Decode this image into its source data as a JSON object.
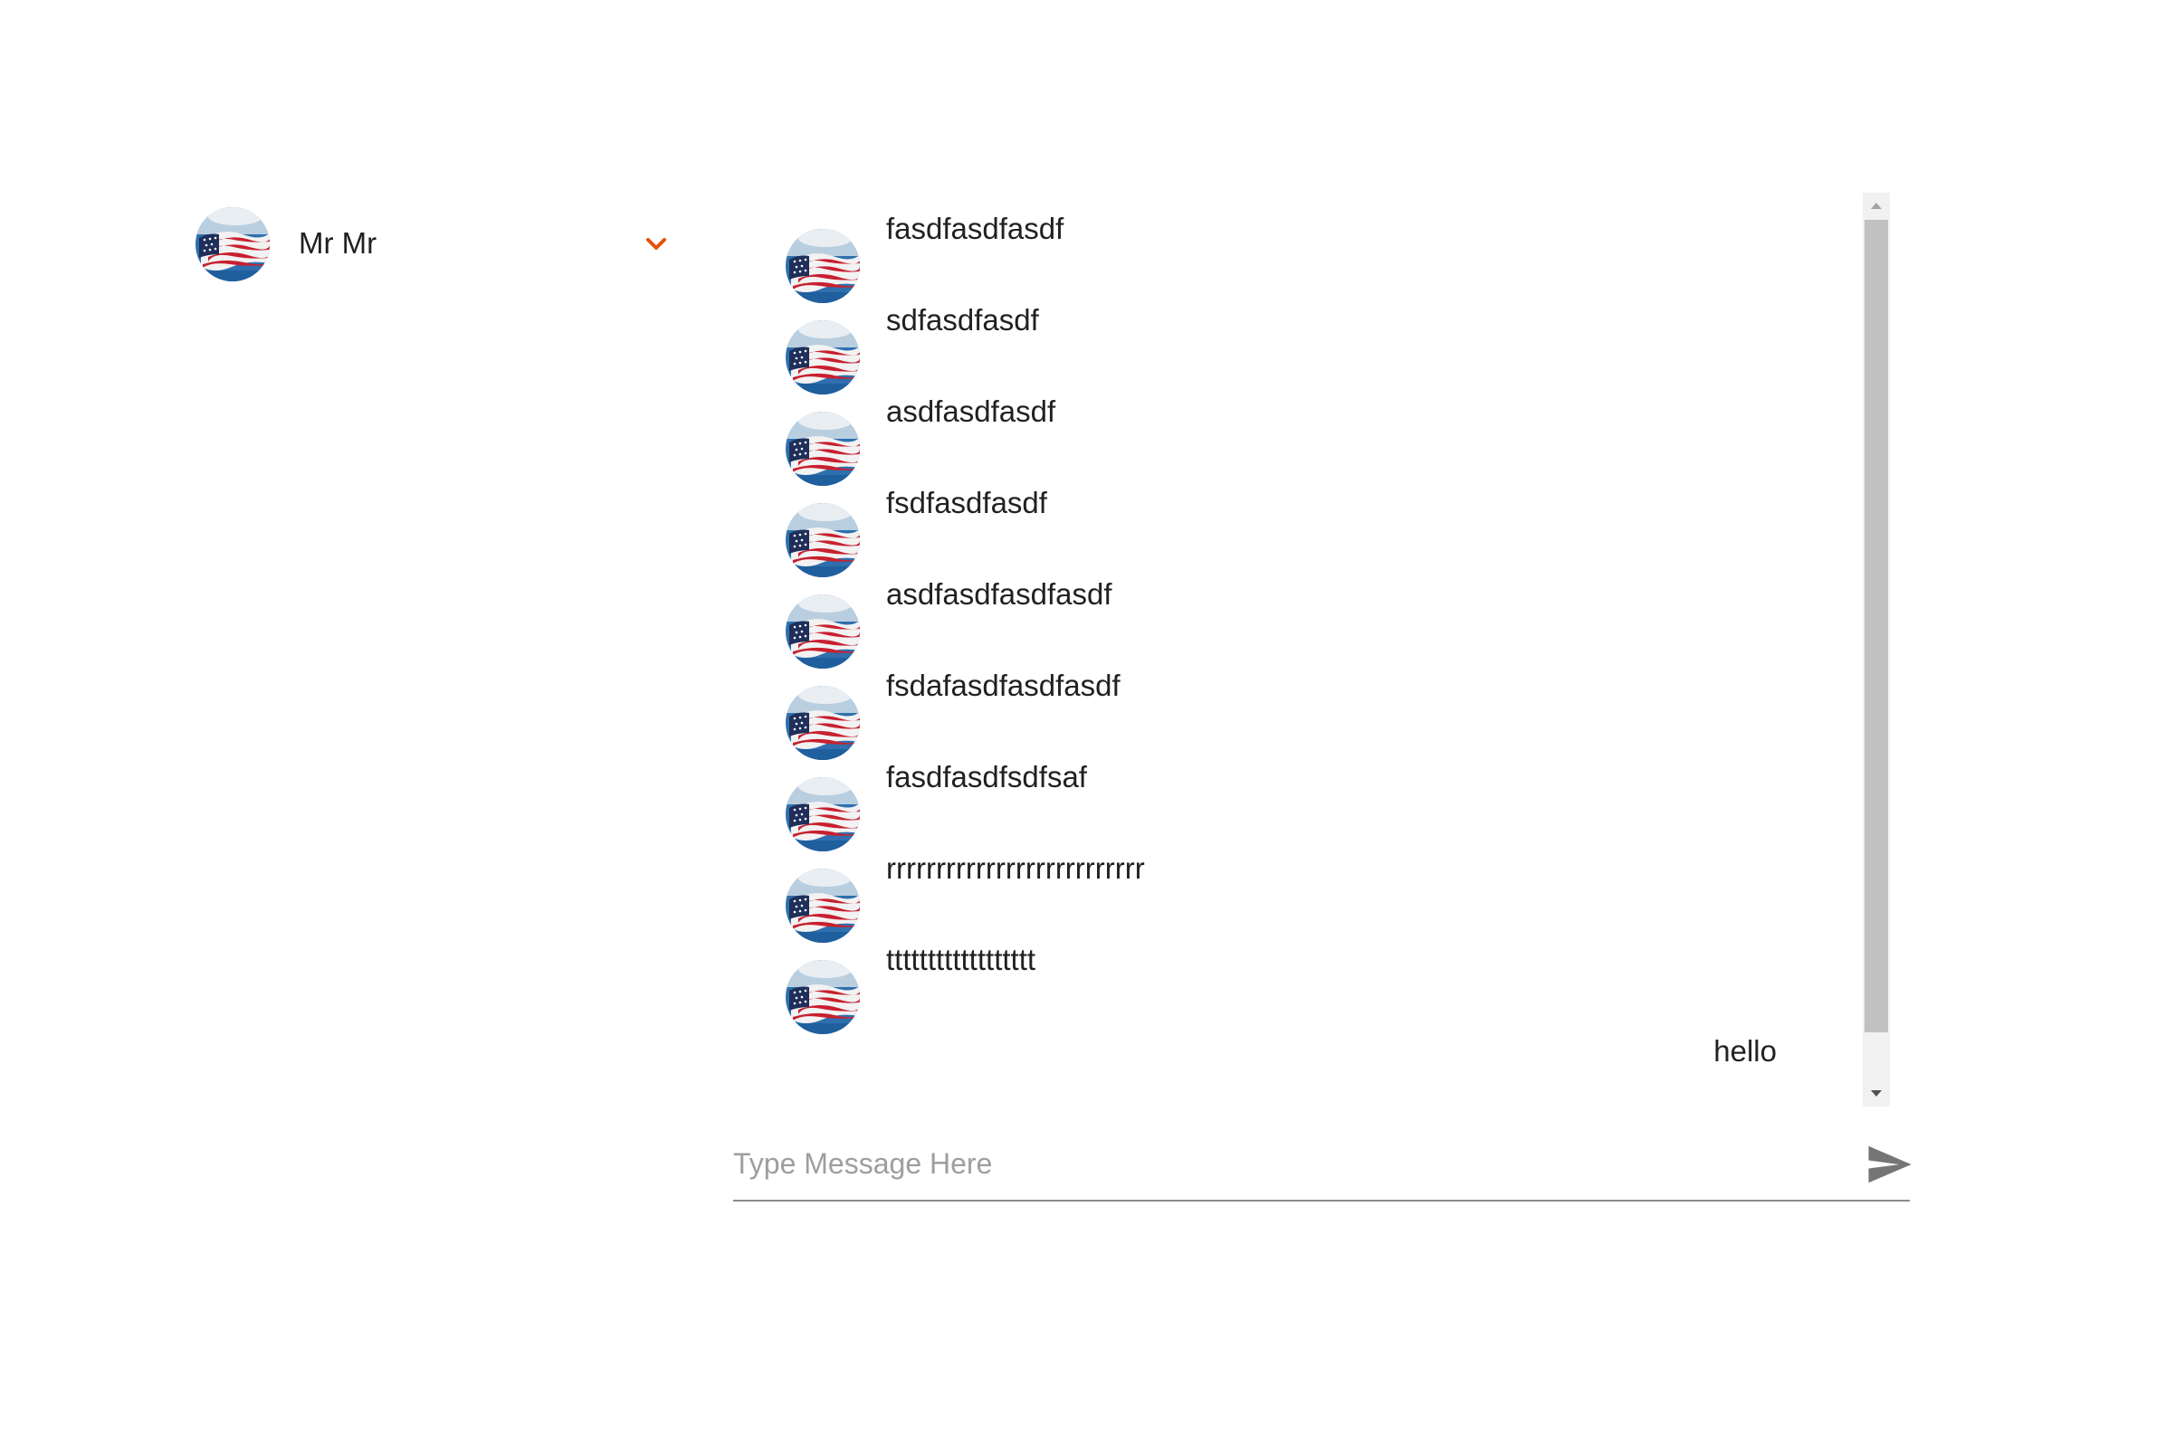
{
  "contact": {
    "name": "Mr Mr",
    "avatar_icon": "flag-avatar",
    "expand_icon": "chevron-down-icon",
    "accent_color": "#e65100"
  },
  "messages": [
    {
      "text": "fasdfasdfasdf",
      "incoming": true
    },
    {
      "text": "sdfasdfasdf",
      "incoming": true
    },
    {
      "text": "asdfasdfasdf",
      "incoming": true
    },
    {
      "text": "fsdfasdfasdf",
      "incoming": true
    },
    {
      "text": "asdfasdfasdfasdf",
      "incoming": true
    },
    {
      "text": "fsdafasdfasdfasdf",
      "incoming": true
    },
    {
      "text": "fasdfasdfsdfsaf",
      "incoming": true
    },
    {
      "text": "rrrrrrrrrrrrrrrrrrrrrrrrrr",
      "incoming": true
    },
    {
      "text": "tttttttttttttttttt",
      "incoming": true
    },
    {
      "text": "hello",
      "incoming": false
    }
  ],
  "composer": {
    "placeholder": "Type Message Here",
    "value": "",
    "send_icon": "send-icon"
  }
}
